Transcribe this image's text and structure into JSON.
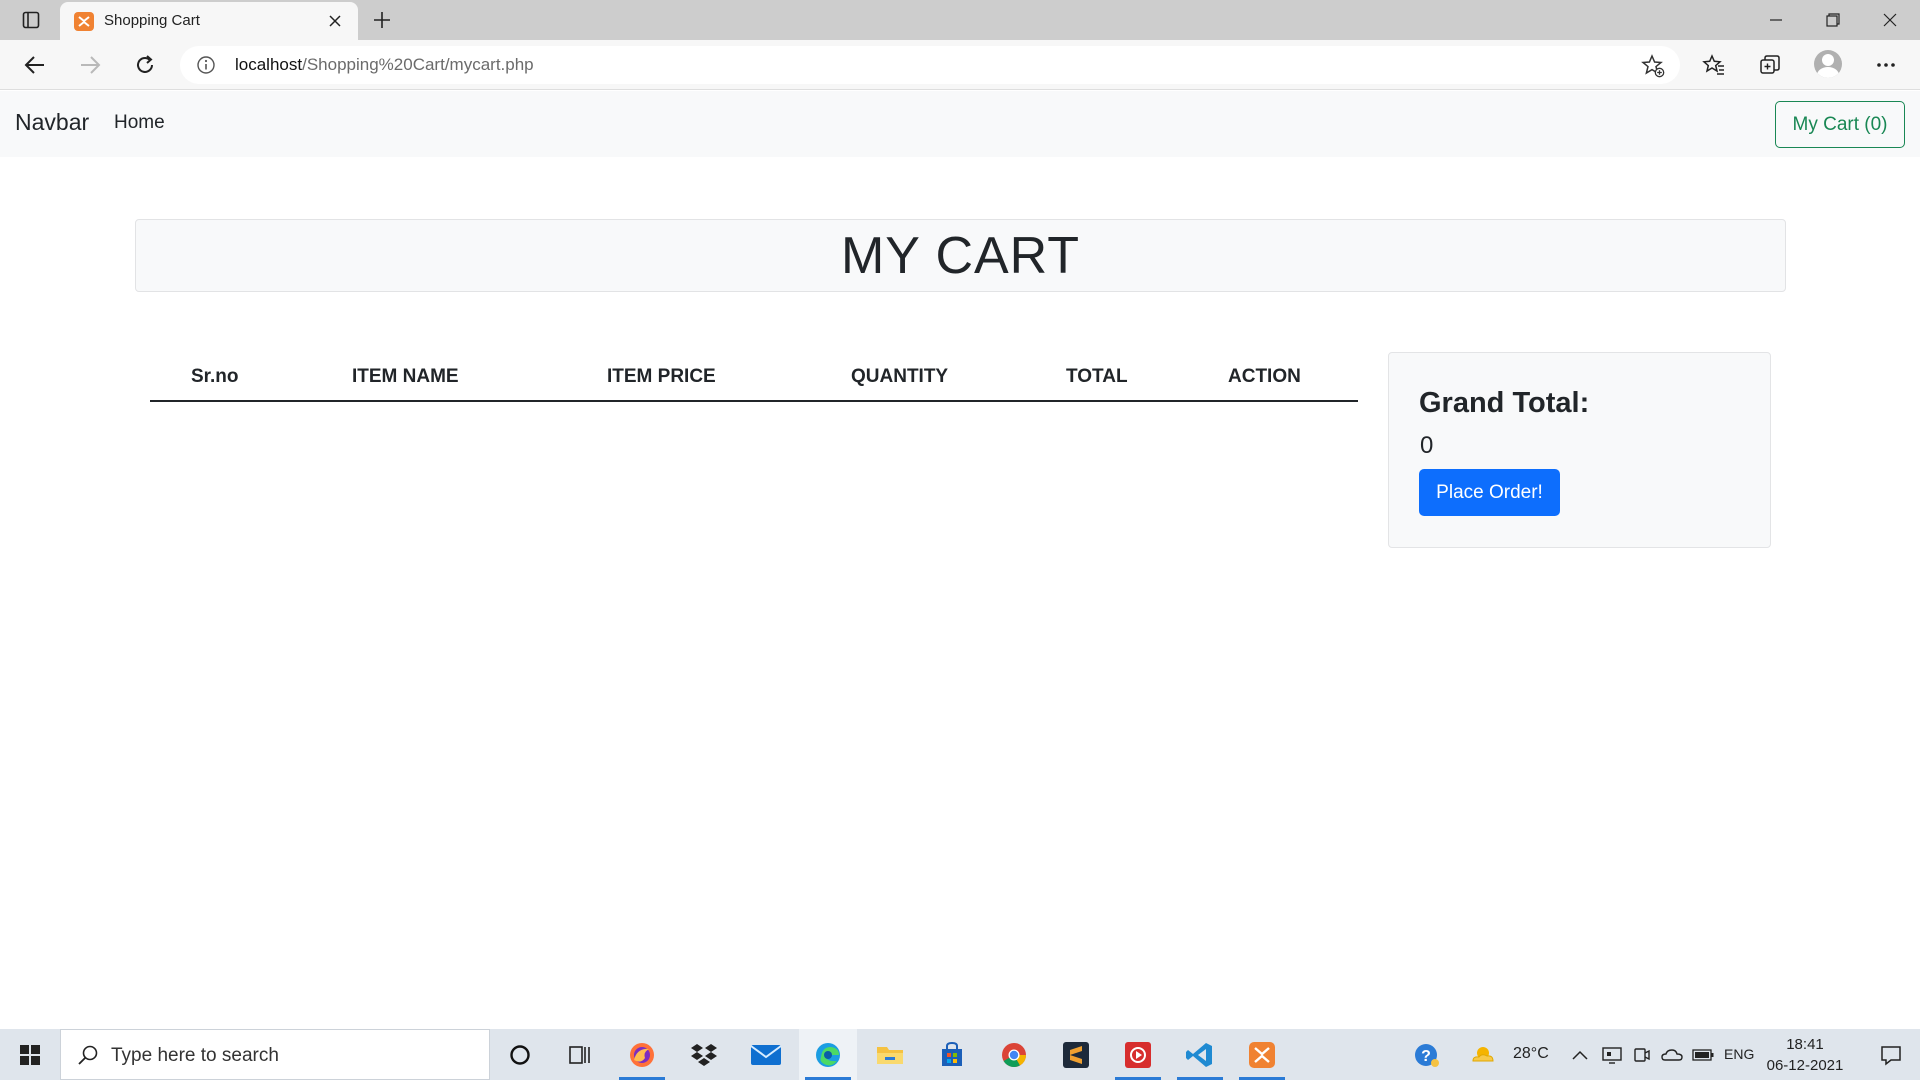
{
  "browser": {
    "tab_title": "Shopping Cart",
    "url_host": "localhost",
    "url_path": "/Shopping%20Cart/mycart.php"
  },
  "navbar": {
    "brand": "Navbar",
    "home_link": "Home",
    "cart_button": "My Cart (0)"
  },
  "hero": {
    "title": "MY CART"
  },
  "table": {
    "headers": [
      "Sr.no",
      "ITEM NAME",
      "ITEM PRICE",
      "QUANTITY",
      "TOTAL",
      "ACTION"
    ],
    "rows": []
  },
  "summary": {
    "grand_total_label": "Grand Total:",
    "grand_total_value": "0",
    "place_order_button": "Place Order!"
  },
  "taskbar": {
    "search_placeholder": "Type here to search",
    "weather": "28°C",
    "language": "ENG",
    "time": "18:41",
    "date": "06-12-2021",
    "apps": [
      "cortana-icon",
      "task-view-icon",
      "firefox-icon",
      "dropbox-icon",
      "mail-icon",
      "edge-icon",
      "file-explorer-icon",
      "store-icon",
      "chrome-icon",
      "sublime-text-icon",
      "media-player-icon",
      "vscode-icon",
      "xampp-icon"
    ]
  },
  "colors": {
    "success": "#198754",
    "primary": "#0d6efd",
    "navbar_bg": "#f8f9fa"
  }
}
